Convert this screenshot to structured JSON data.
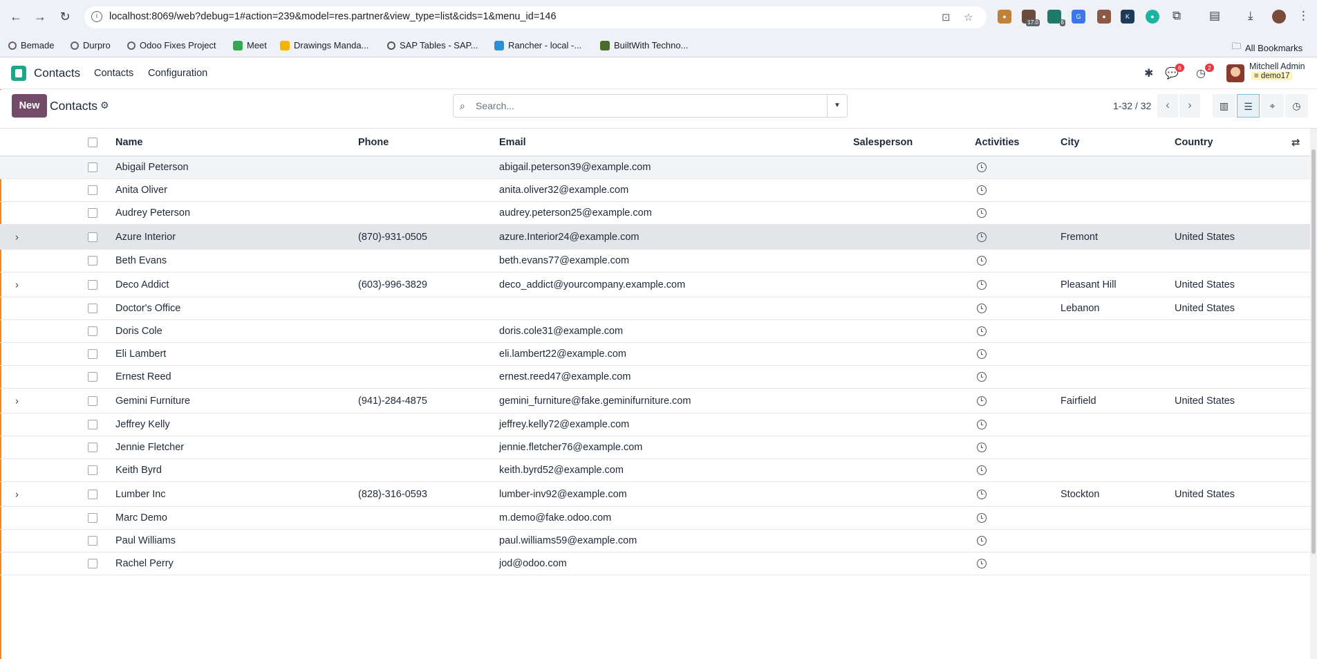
{
  "browser": {
    "url": "localhost:8069/web?debug=1#action=239&model=res.partner&view_type=list&cids=1&menu_id=146",
    "ext_badge_1": "17.0",
    "ext_badge_2": "6",
    "bookmarks": [
      "Bemade",
      "Durpro",
      "Odoo Fixes Project",
      "Meet",
      "Drawings Manda...",
      "SAP Tables - SAP...",
      "Rancher - local -...",
      "BuiltWith Techno..."
    ],
    "all_bookmarks": "All Bookmarks"
  },
  "navbar": {
    "app": "Contacts",
    "menu": [
      "Contacts",
      "Configuration"
    ],
    "messages_count": "6",
    "activities_count": "2",
    "user_name": "Mitchell Admin",
    "user_db": "demo17"
  },
  "control_panel": {
    "new_label": "New",
    "title": "Contacts",
    "search_placeholder": "Search...",
    "pager": "1-32 / 32"
  },
  "table": {
    "columns": [
      "Name",
      "Phone",
      "Email",
      "Salesperson",
      "Activities",
      "City",
      "Country"
    ],
    "rows": [
      {
        "name": "Abigail Peterson",
        "phone": "",
        "email": "abigail.peterson39@example.com",
        "salesperson": "",
        "city": "",
        "country": "",
        "company": false
      },
      {
        "name": "Anita Oliver",
        "phone": "",
        "email": "anita.oliver32@example.com",
        "salesperson": "",
        "city": "",
        "country": "",
        "company": false
      },
      {
        "name": "Audrey Peterson",
        "phone": "",
        "email": "audrey.peterson25@example.com",
        "salesperson": "",
        "city": "",
        "country": "",
        "company": false
      },
      {
        "name": "Azure Interior",
        "phone": "(870)-931-0505",
        "email": "azure.Interior24@example.com",
        "salesperson": "",
        "city": "Fremont",
        "country": "United States",
        "company": true
      },
      {
        "name": "Beth Evans",
        "phone": "",
        "email": "beth.evans77@example.com",
        "salesperson": "",
        "city": "",
        "country": "",
        "company": false
      },
      {
        "name": "Deco Addict",
        "phone": "(603)-996-3829",
        "email": "deco_addict@yourcompany.example.com",
        "salesperson": "",
        "city": "Pleasant Hill",
        "country": "United States",
        "company": true
      },
      {
        "name": "Doctor's Office",
        "phone": "",
        "email": "",
        "salesperson": "",
        "city": "Lebanon",
        "country": "United States",
        "company": false
      },
      {
        "name": "Doris Cole",
        "phone": "",
        "email": "doris.cole31@example.com",
        "salesperson": "",
        "city": "",
        "country": "",
        "company": false
      },
      {
        "name": "Eli Lambert",
        "phone": "",
        "email": "eli.lambert22@example.com",
        "salesperson": "",
        "city": "",
        "country": "",
        "company": false
      },
      {
        "name": "Ernest Reed",
        "phone": "",
        "email": "ernest.reed47@example.com",
        "salesperson": "",
        "city": "",
        "country": "",
        "company": false
      },
      {
        "name": "Gemini Furniture",
        "phone": "(941)-284-4875",
        "email": "gemini_furniture@fake.geminifurniture.com",
        "salesperson": "",
        "city": "Fairfield",
        "country": "United States",
        "company": true
      },
      {
        "name": "Jeffrey Kelly",
        "phone": "",
        "email": "jeffrey.kelly72@example.com",
        "salesperson": "",
        "city": "",
        "country": "",
        "company": false
      },
      {
        "name": "Jennie Fletcher",
        "phone": "",
        "email": "jennie.fletcher76@example.com",
        "salesperson": "",
        "city": "",
        "country": "",
        "company": false
      },
      {
        "name": "Keith Byrd",
        "phone": "",
        "email": "keith.byrd52@example.com",
        "salesperson": "",
        "city": "",
        "country": "",
        "company": false
      },
      {
        "name": "Lumber Inc",
        "phone": "(828)-316-0593",
        "email": "lumber-inv92@example.com",
        "salesperson": "",
        "city": "Stockton",
        "country": "United States",
        "company": true
      },
      {
        "name": "Marc Demo",
        "phone": "",
        "email": "m.demo@fake.odoo.com",
        "salesperson": "",
        "city": "",
        "country": "",
        "company": false
      },
      {
        "name": "Paul Williams",
        "phone": "",
        "email": "paul.williams59@example.com",
        "salesperson": "",
        "city": "",
        "country": "",
        "company": false
      },
      {
        "name": "Rachel Perry",
        "phone": "",
        "email": "jod@odoo.com",
        "salesperson": "",
        "city": "",
        "country": "",
        "company": false
      }
    ]
  },
  "colors": {
    "primary": "#714b67",
    "app_icon": "#1ea787",
    "badge": "#e63946"
  }
}
